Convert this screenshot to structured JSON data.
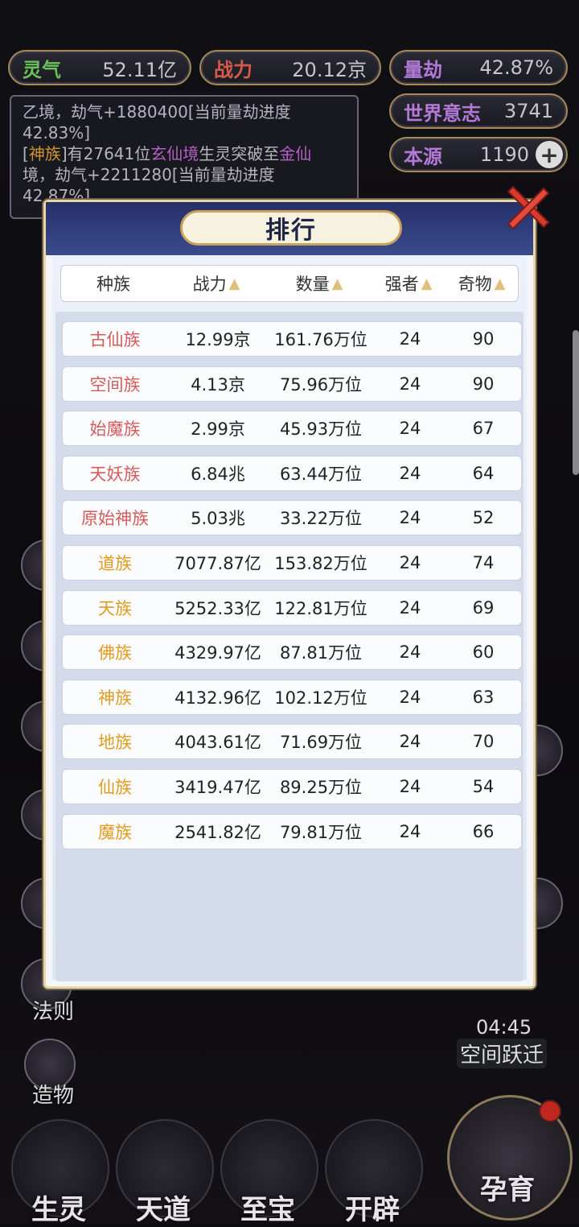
{
  "stats": {
    "lingqi": {
      "label": "灵气",
      "value": "52.11亿"
    },
    "zhanli": {
      "label": "战力",
      "value": "20.12京"
    },
    "liangjie": {
      "label": "量劫",
      "value": "42.87%"
    },
    "world_will": {
      "label": "世界意志",
      "value": "3741"
    },
    "benyuan": {
      "label": "本源",
      "value": "1190"
    }
  },
  "log": {
    "line1_pre": "乙境，劫气+1880400[当前量劫进度",
    "line1_post": "42.83%]",
    "line2_race": "神族",
    "line2_a": "有27641位",
    "line2_realm": "玄仙境",
    "line2_b": "生灵突破至",
    "line2_realm2": "金仙",
    "line3": "境，劫气+2211280[当前量劫进度",
    "line4": "42.87%]"
  },
  "side_labels": [
    "法则",
    "造物"
  ],
  "timer": "04:45",
  "space_jump": "空间跃迁",
  "bottom_nav": [
    "生灵",
    "天道",
    "至宝",
    "开辟"
  ],
  "big_button": "孕育",
  "modal": {
    "title": "排行",
    "headers": [
      "种族",
      "战力",
      "数量",
      "强者",
      "奇物"
    ],
    "rows": [
      {
        "name": "古仙族",
        "power": "12.99京",
        "count": "161.76万位",
        "strong": "24",
        "treasure": "90",
        "tier": "red"
      },
      {
        "name": "空间族",
        "power": "4.13京",
        "count": "75.96万位",
        "strong": "24",
        "treasure": "90",
        "tier": "red"
      },
      {
        "name": "始魔族",
        "power": "2.99京",
        "count": "45.93万位",
        "strong": "24",
        "treasure": "67",
        "tier": "red"
      },
      {
        "name": "天妖族",
        "power": "6.84兆",
        "count": "63.44万位",
        "strong": "24",
        "treasure": "64",
        "tier": "red"
      },
      {
        "name": "原始神族",
        "power": "5.03兆",
        "count": "33.22万位",
        "strong": "24",
        "treasure": "52",
        "tier": "red"
      },
      {
        "name": "道族",
        "power": "7077.87亿",
        "count": "153.82万位",
        "strong": "24",
        "treasure": "74",
        "tier": "gold"
      },
      {
        "name": "天族",
        "power": "5252.33亿",
        "count": "122.81万位",
        "strong": "24",
        "treasure": "69",
        "tier": "gold"
      },
      {
        "name": "佛族",
        "power": "4329.97亿",
        "count": "87.81万位",
        "strong": "24",
        "treasure": "60",
        "tier": "gold"
      },
      {
        "name": "神族",
        "power": "4132.96亿",
        "count": "102.12万位",
        "strong": "24",
        "treasure": "63",
        "tier": "gold"
      },
      {
        "name": "地族",
        "power": "4043.61亿",
        "count": "71.69万位",
        "strong": "24",
        "treasure": "70",
        "tier": "gold"
      },
      {
        "name": "仙族",
        "power": "3419.47亿",
        "count": "89.25万位",
        "strong": "24",
        "treasure": "54",
        "tier": "gold"
      },
      {
        "name": "魔族",
        "power": "2541.82亿",
        "count": "79.81万位",
        "strong": "24",
        "treasure": "66",
        "tier": "gold"
      }
    ]
  },
  "icons": [
    "plus-icon",
    "close-icon",
    "sort-arrow-icon"
  ],
  "colors": {
    "tier_red": "#d75a5a",
    "tier_gold": "#e39a1e",
    "header_blue": "#26306a"
  }
}
